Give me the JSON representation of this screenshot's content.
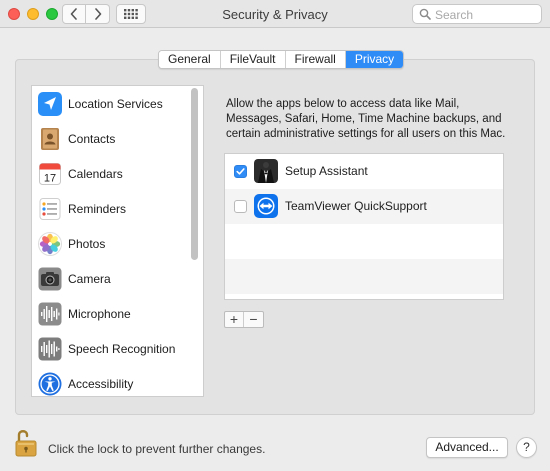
{
  "window": {
    "title": "Security & Privacy"
  },
  "search": {
    "placeholder": "Search"
  },
  "tabs": [
    {
      "label": "General",
      "active": false
    },
    {
      "label": "FileVault",
      "active": false
    },
    {
      "label": "Firewall",
      "active": false
    },
    {
      "label": "Privacy",
      "active": true
    }
  ],
  "sidebar": {
    "items": [
      {
        "label": "Location Services",
        "icon": "location-arrow-icon"
      },
      {
        "label": "Contacts",
        "icon": "contacts-book-icon"
      },
      {
        "label": "Calendars",
        "icon": "calendar-icon",
        "icon_text": "17"
      },
      {
        "label": "Reminders",
        "icon": "reminders-list-icon"
      },
      {
        "label": "Photos",
        "icon": "photos-flower-icon"
      },
      {
        "label": "Camera",
        "icon": "camera-icon"
      },
      {
        "label": "Microphone",
        "icon": "microphone-waveform-icon"
      },
      {
        "label": "Speech Recognition",
        "icon": "speech-waveform-icon"
      },
      {
        "label": "Accessibility",
        "icon": "accessibility-icon"
      }
    ]
  },
  "privacy": {
    "description_lines": [
      "Allow the apps below to access data like Mail,",
      "Messages, Safari, Home, Time Machine backups, and",
      "certain administrative settings for all users on this Mac."
    ],
    "apps": [
      {
        "label": "Setup Assistant",
        "checked": true,
        "icon": "setup-assistant-icon"
      },
      {
        "label": "TeamViewer QuickSupport",
        "checked": false,
        "icon": "teamviewer-icon"
      }
    ],
    "add_label": "+",
    "remove_label": "−"
  },
  "footer": {
    "lock_text": "Click the lock to prevent further changes.",
    "advanced_label": "Advanced...",
    "help_label": "?"
  },
  "colors": {
    "accent": "#2f8bf6",
    "window_bg": "#ececec",
    "close": "#fc5f57",
    "minimize": "#fdbc2e",
    "zoom": "#29c840"
  }
}
